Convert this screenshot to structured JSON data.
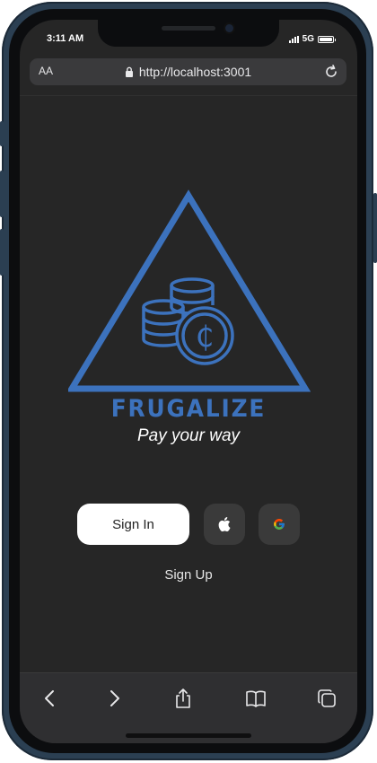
{
  "status_bar": {
    "time": "3:11 AM",
    "network": "5G"
  },
  "browser": {
    "text_size_label": "AA",
    "url": "http://localhost:3001"
  },
  "app": {
    "brand_name": "FRUGALIZE",
    "tagline": "Pay your way",
    "signin_label": "Sign In",
    "signup_label": "Sign Up"
  },
  "icons": {
    "logo": "coins-in-triangle-logo",
    "apple": "apple-icon",
    "google": "google-icon",
    "back": "chevron-left-icon",
    "forward": "chevron-right-icon",
    "share": "share-icon",
    "bookmarks": "book-icon",
    "tabs": "tabs-icon"
  },
  "colors": {
    "background": "#262626",
    "brand": "#3c72bd",
    "button_light": "#ffffff",
    "button_dark": "#3a3a3a"
  }
}
